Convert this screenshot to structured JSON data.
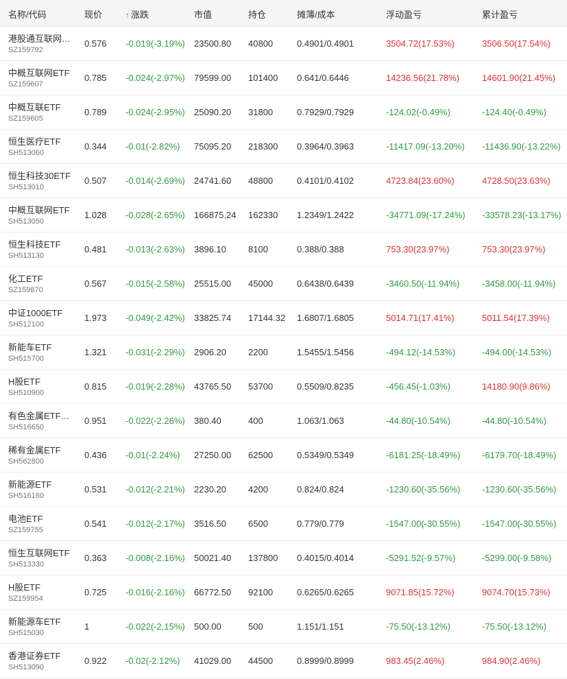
{
  "header": {
    "name_code": "名称/代码",
    "price": "现价",
    "change": "涨跌",
    "market_value": "市值",
    "position": "持仓",
    "cost": "摊薄/成本",
    "float_pl": "浮动盈亏",
    "total_pl": "累计盈亏",
    "sort_icon": "arrow-up-icon"
  },
  "colors": {
    "gain": "#e0312b",
    "loss": "#2e9b3c",
    "sort_arrow": "#1e88e5",
    "header_bg": "#f5f5f5"
  },
  "rows": [
    {
      "name": "港股通互联网…",
      "code": "SZ159792",
      "price": "0.576",
      "change": "-0.019(-3.19%)",
      "mv": "23500.80",
      "pos": "40800",
      "cost": "0.4901/0.4901",
      "float_pl": "3504.72(17.53%)",
      "total_pl": "3506.50(17.54%)",
      "float_sign": "pos",
      "total_sign": "pos"
    },
    {
      "name": "中概互联网ETF",
      "code": "SZ159607",
      "price": "0.785",
      "change": "-0.024(-2.97%)",
      "mv": "79599.00",
      "pos": "101400",
      "cost": "0.641/0.6446",
      "float_pl": "14236.56(21.78%)",
      "total_pl": "14601.90(21.45%)",
      "float_sign": "pos",
      "total_sign": "pos"
    },
    {
      "name": "中概互联ETF",
      "code": "SZ159605",
      "price": "0.789",
      "change": "-0.024(-2.95%)",
      "mv": "25090.20",
      "pos": "31800",
      "cost": "0.7929/0.7929",
      "float_pl": "-124.02(-0.49%)",
      "total_pl": "-124.40(-0.49%)",
      "float_sign": "neg",
      "total_sign": "neg"
    },
    {
      "name": "恒生医疗ETF",
      "code": "SH513060",
      "price": "0.344",
      "change": "-0.01(-2.82%)",
      "mv": "75095.20",
      "pos": "218300",
      "cost": "0.3964/0.3963",
      "float_pl": "-11417.09(-13.20%)",
      "total_pl": "-11436.90(-13.22%)",
      "float_sign": "neg",
      "total_sign": "neg"
    },
    {
      "name": "恒生科技30ETF",
      "code": "SH513010",
      "price": "0.507",
      "change": "-0.014(-2.69%)",
      "mv": "24741.60",
      "pos": "48800",
      "cost": "0.4101/0.4102",
      "float_pl": "4723.84(23.60%)",
      "total_pl": "4728.50(23.63%)",
      "float_sign": "pos",
      "total_sign": "pos"
    },
    {
      "name": "中概互联网ETF",
      "code": "SH513050",
      "price": "1.028",
      "change": "-0.028(-2.65%)",
      "mv": "166875.24",
      "pos": "162330",
      "cost": "1.2349/1.2422",
      "float_pl": "-34771.09(-17.24%)",
      "total_pl": "-33578.23(-13.17%)",
      "float_sign": "neg",
      "total_sign": "neg"
    },
    {
      "name": "恒生科技ETF",
      "code": "SH513130",
      "price": "0.481",
      "change": "-0.013(-2.63%)",
      "mv": "3896.10",
      "pos": "8100",
      "cost": "0.388/0.388",
      "float_pl": "753.30(23.97%)",
      "total_pl": "753.30(23.97%)",
      "float_sign": "pos",
      "total_sign": "pos"
    },
    {
      "name": "化工ETF",
      "code": "SZ159870",
      "price": "0.567",
      "change": "-0.015(-2.58%)",
      "mv": "25515.00",
      "pos": "45000",
      "cost": "0.6438/0.6439",
      "float_pl": "-3460.50(-11.94%)",
      "total_pl": "-3458.00(-11.94%)",
      "float_sign": "neg",
      "total_sign": "neg"
    },
    {
      "name": "中证1000ETF",
      "code": "SH512100",
      "price": "1.973",
      "change": "-0.049(-2.42%)",
      "mv": "33825.74",
      "pos": "17144.32",
      "cost": "1.6807/1.6805",
      "float_pl": "5014.71(17.41%)",
      "total_pl": "5011.54(17.39%)",
      "float_sign": "pos",
      "total_sign": "pos"
    },
    {
      "name": "新能车ETF",
      "code": "SH515700",
      "price": "1.321",
      "change": "-0.031(-2.29%)",
      "mv": "2906.20",
      "pos": "2200",
      "cost": "1.5455/1.5456",
      "float_pl": "-494.12(-14.53%)",
      "total_pl": "-494.00(-14.53%)",
      "float_sign": "neg",
      "total_sign": "neg"
    },
    {
      "name": "H股ETF",
      "code": "SH510900",
      "price": "0.815",
      "change": "-0.019(-2.28%)",
      "mv": "43765.50",
      "pos": "53700",
      "cost": "0.5509/0.8235",
      "float_pl": "-456.45(-1.03%)",
      "total_pl": "14180.90(9.86%)",
      "float_sign": "neg",
      "total_sign": "pos"
    },
    {
      "name": "有色金属ETF…",
      "code": "SH516650",
      "price": "0.951",
      "change": "-0.022(-2.26%)",
      "mv": "380.40",
      "pos": "400",
      "cost": "1.063/1.063",
      "float_pl": "-44.80(-10.54%)",
      "total_pl": "-44.80(-10.54%)",
      "float_sign": "neg",
      "total_sign": "neg"
    },
    {
      "name": "稀有金属ETF",
      "code": "SH562800",
      "price": "0.436",
      "change": "-0.01(-2.24%)",
      "mv": "27250.00",
      "pos": "62500",
      "cost": "0.5349/0.5349",
      "float_pl": "-6181.25(-18.49%)",
      "total_pl": "-6179.70(-18.49%)",
      "float_sign": "neg",
      "total_sign": "neg"
    },
    {
      "name": "新能源ETF",
      "code": "SH516160",
      "price": "0.531",
      "change": "-0.012(-2.21%)",
      "mv": "2230.20",
      "pos": "4200",
      "cost": "0.824/0.824",
      "float_pl": "-1230.60(-35.56%)",
      "total_pl": "-1230.60(-35.56%)",
      "float_sign": "neg",
      "total_sign": "neg"
    },
    {
      "name": "电池ETF",
      "code": "SZ159755",
      "price": "0.541",
      "change": "-0.012(-2.17%)",
      "mv": "3516.50",
      "pos": "6500",
      "cost": "0.779/0.779",
      "float_pl": "-1547.00(-30.55%)",
      "total_pl": "-1547.00(-30.55%)",
      "float_sign": "neg",
      "total_sign": "neg"
    },
    {
      "name": "恒生互联网ETF",
      "code": "SH513330",
      "price": "0.363",
      "change": "-0.008(-2.16%)",
      "mv": "50021.40",
      "pos": "137800",
      "cost": "0.4015/0.4014",
      "float_pl": "-5291.52(-9.57%)",
      "total_pl": "-5299.00(-9.58%)",
      "float_sign": "neg",
      "total_sign": "neg"
    },
    {
      "name": "H股ETF",
      "code": "SZ159954",
      "price": "0.725",
      "change": "-0.016(-2.16%)",
      "mv": "66772.50",
      "pos": "92100",
      "cost": "0.6265/0.6265",
      "float_pl": "9071.85(15.72%)",
      "total_pl": "9074.70(15.73%)",
      "float_sign": "pos",
      "total_sign": "pos"
    },
    {
      "name": "新能源车ETF",
      "code": "SH515030",
      "price": "1",
      "change": "-0.022(-2.15%)",
      "mv": "500.00",
      "pos": "500",
      "cost": "1.151/1.151",
      "float_pl": "-75.50(-13.12%)",
      "total_pl": "-75.50(-13.12%)",
      "float_sign": "neg",
      "total_sign": "neg"
    },
    {
      "name": "香港证券ETF",
      "code": "SH513090",
      "price": "0.922",
      "change": "-0.02(-2.12%)",
      "mv": "41029.00",
      "pos": "44500",
      "cost": "0.8999/0.8999",
      "float_pl": "983.45(2.46%)",
      "total_pl": "984.90(2.46%)",
      "float_sign": "pos",
      "total_sign": "pos"
    }
  ]
}
